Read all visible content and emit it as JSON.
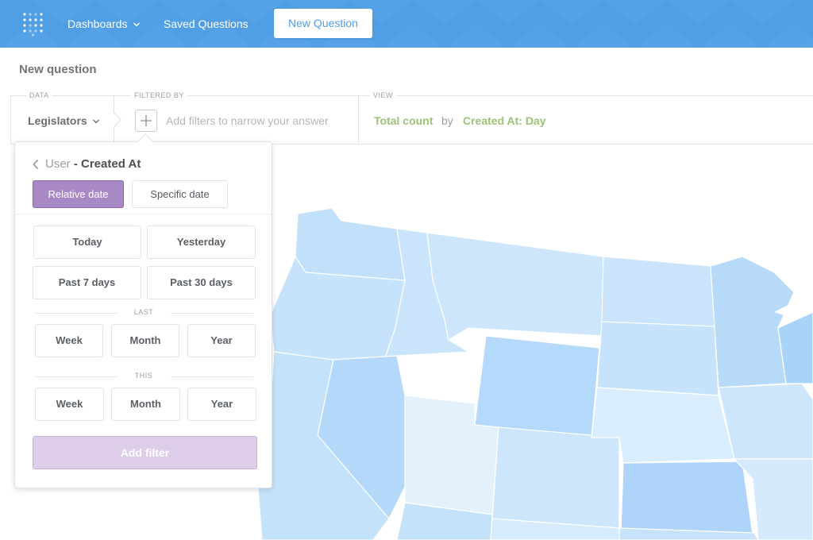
{
  "navbar": {
    "logo_icon": "metabase-logo-icon",
    "dashboards_label": "Dashboards",
    "saved_questions_label": "Saved Questions",
    "new_question_label": "New Question",
    "bg_color": "#509ee3"
  },
  "page": {
    "title": "New question"
  },
  "query_builder": {
    "data_label": "DATA",
    "data_value": "Legislators",
    "filtered_by_label": "FILTERED BY",
    "add_filter_placeholder": "Add filters to narrow your answer",
    "view_label": "VIEW",
    "view_aggregation": "Total count",
    "view_by": "by",
    "view_breakout": "Created At: Day"
  },
  "filter_popover": {
    "header_table": "User",
    "header_separator": " - ",
    "header_field": "Created At",
    "tabs": {
      "relative": "Relative date",
      "specific": "Specific date"
    },
    "active_tab": "relative",
    "quick_options": [
      "Today",
      "Yesterday",
      "Past 7 days",
      "Past 30 days"
    ],
    "last_label": "LAST",
    "last_options": [
      "Week",
      "Month",
      "Year"
    ],
    "this_label": "THIS",
    "this_options": [
      "Week",
      "Month",
      "Year"
    ],
    "submit_label": "Add filter",
    "accent_color": "#a989c5"
  },
  "map": {
    "type": "us-states-choropleth",
    "base_color": "#c7e3fb"
  }
}
